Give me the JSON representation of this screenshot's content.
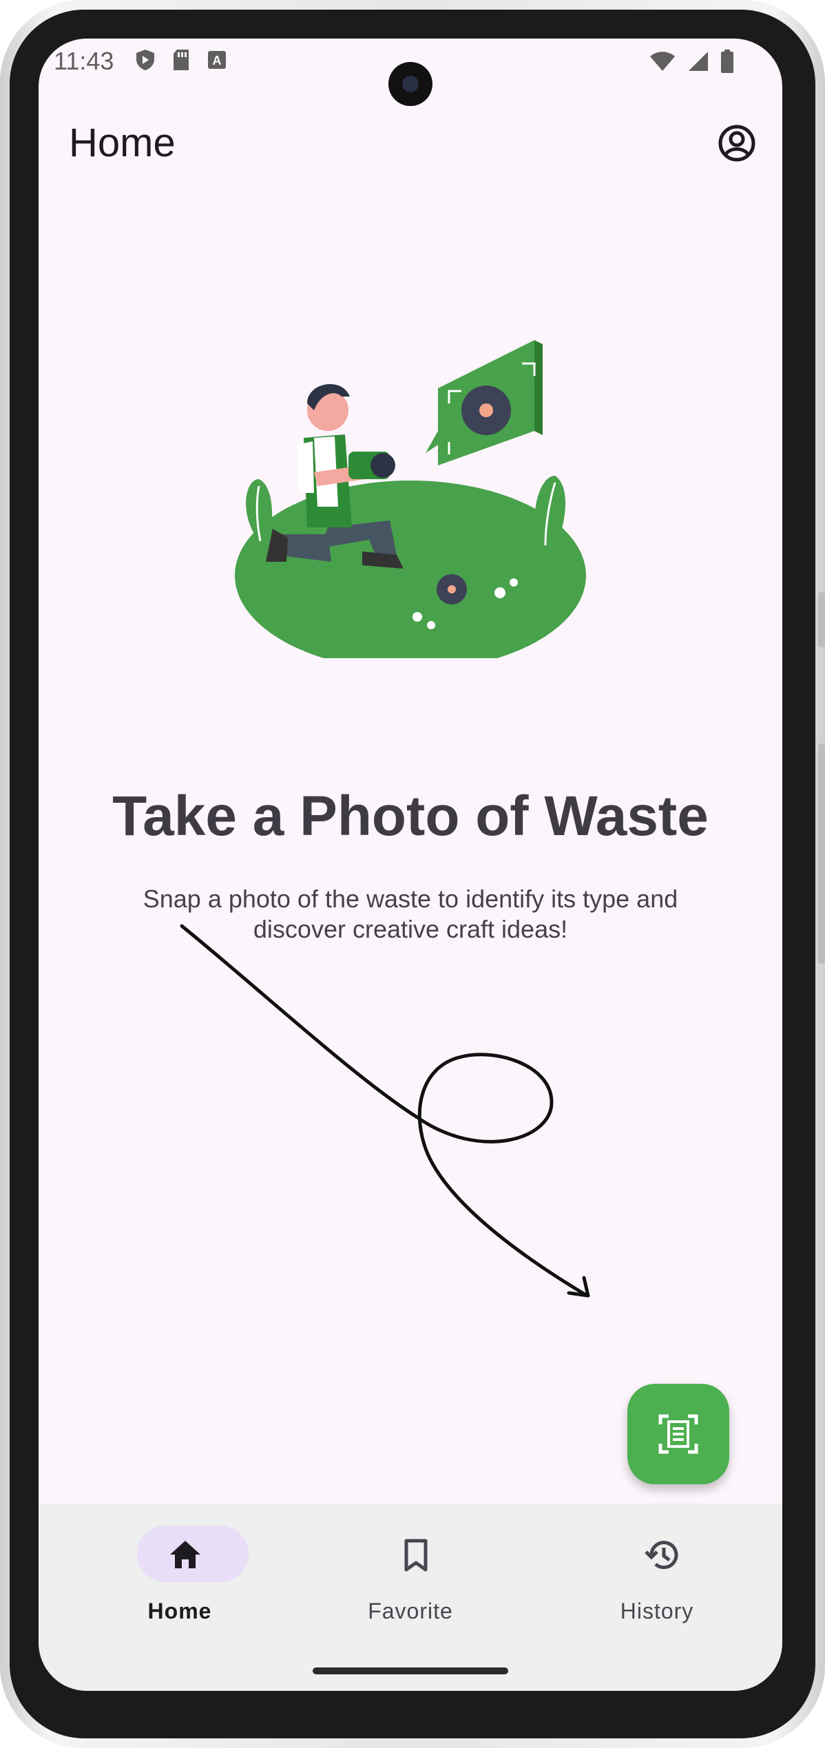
{
  "status_bar": {
    "time": "11:43",
    "left_icons": [
      "shield-icon",
      "sd-card-icon",
      "keyboard-a-icon"
    ],
    "right_icons": [
      "wifi-icon",
      "signal-icon",
      "battery-icon"
    ]
  },
  "app_bar": {
    "title": "Home",
    "action_icon": "account-circle-icon"
  },
  "main": {
    "illustration": "person-photographing-flower-illustration",
    "headline": "Take a Photo of Waste",
    "subtext": "Snap a photo of the waste to identify its type and discover creative craft ideas!"
  },
  "fab": {
    "icon": "document-scanner-icon",
    "color": "#4caf50"
  },
  "bottom_nav": {
    "items": [
      {
        "label": "Home",
        "icon": "home-icon",
        "active": true
      },
      {
        "label": "Favorite",
        "icon": "bookmark-icon",
        "active": false
      },
      {
        "label": "History",
        "icon": "history-icon",
        "active": false
      }
    ]
  },
  "colors": {
    "background": "#fcf5fb",
    "accent_green": "#4caf50",
    "active_pill": "#e8def7",
    "nav_background": "#eeefef"
  }
}
